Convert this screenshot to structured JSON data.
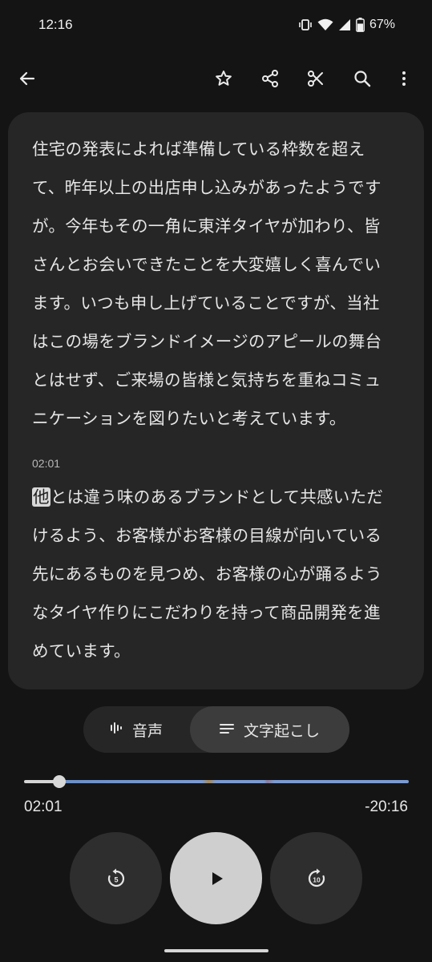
{
  "status_bar": {
    "time": "12:16",
    "battery_percent": "67%",
    "battery_level": 0.67,
    "icons": [
      "vibrate-icon",
      "wifi-icon",
      "signal-icon",
      "battery-icon"
    ]
  },
  "toolbar": {
    "icons": [
      "back-arrow-icon",
      "star-icon",
      "share-icon",
      "scissors-icon",
      "search-icon",
      "more-vert-icon"
    ]
  },
  "transcript": {
    "paragraph_1": "住宅の発表によれば準備している枠数を超え\nて、昨年以上の出店申し込みがあったようです\nが。今年もその一角に東洋タイヤが加わり、皆\nさんとお会いできたことを大変嬉しく喜んでい\nます。いつも申し上げていることですが、当社\nはこの場をブランドイメージのアピールの舞台\nとはせず、ご来場の皆様と気持ちを重ねコミュ\nニケーションを図りたいと考えています。",
    "timestamp_2": "02:01",
    "highlighted_word": "他",
    "paragraph_2_rest": "とは違う味のあるブランドとして共感いただ\nけるよう、お客様がお客様の目線が向いている\n先にあるものを見つめ、お客様の心が踊るよう\nなタイヤ作りにこだわりを持って商品開発を進\nめています。"
  },
  "mode_toggle": {
    "audio_label": "音声",
    "transcript_label": "文字起こし",
    "selected": "transcript"
  },
  "playback": {
    "elapsed": "02:01",
    "remaining": "-20:16",
    "progress_fraction": 0.092,
    "rewind_seconds": "5",
    "forward_seconds": "10"
  },
  "colors": {
    "background": "#141414",
    "card": "#262626",
    "accent_track": "#7b9bd0",
    "play_button": "#cfcfcf"
  }
}
